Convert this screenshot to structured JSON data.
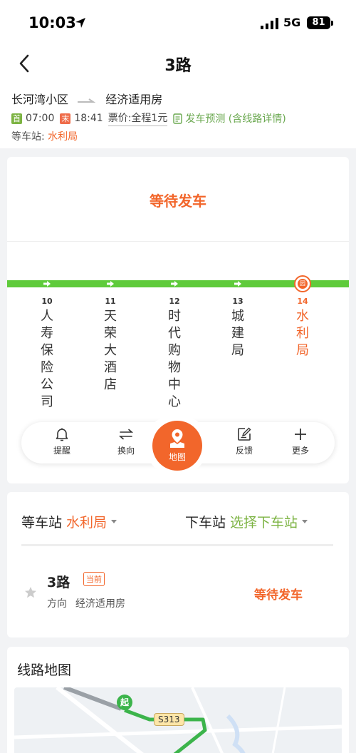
{
  "status_bar": {
    "time": "10:03",
    "network": "5G",
    "battery": "81"
  },
  "header": {
    "title": "3路"
  },
  "route": {
    "from": "长河湾小区",
    "to": "经济适用房",
    "first_tag": "首",
    "first_time": "07:00",
    "last_tag": "末",
    "last_time": "18:41",
    "fare": "票价:全程1元",
    "forecast": "发车预测 (含线路详情)",
    "wait_label": "等车站:",
    "wait_station": "水利局"
  },
  "line_panel": {
    "status": "等待发车",
    "pin_label": "园",
    "stops": [
      {
        "num": "10",
        "name": "人寿保险公司"
      },
      {
        "num": "11",
        "name": "天荣大酒店"
      },
      {
        "num": "12",
        "name": "时代购物中心"
      },
      {
        "num": "13",
        "name": "城建局"
      },
      {
        "num": "14",
        "name": "水利局"
      }
    ]
  },
  "toolbar": {
    "remind": "提醒",
    "reverse": "换向",
    "map": "地图",
    "feedback": "反馈",
    "more": "更多"
  },
  "station_select": {
    "wait_label": "等车站",
    "wait_value": "水利局",
    "alight_label": "下车站",
    "alight_value": "选择下车站"
  },
  "bus_item": {
    "name": "3路",
    "badge": "当前",
    "dir_label": "方向",
    "dir_value": "经济适用房",
    "status": "等待发车"
  },
  "route_map": {
    "title": "线路地图",
    "start_label": "起",
    "road_label": "S313"
  },
  "colors": {
    "accent": "#f2662b",
    "green": "#5fcb3b",
    "link_green": "#7cb342"
  }
}
